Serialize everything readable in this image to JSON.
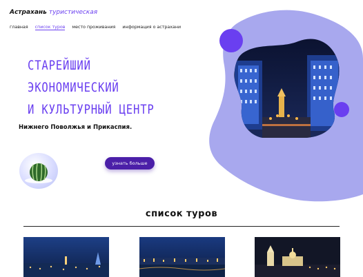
{
  "header": {
    "logo_part1": "Астрахань",
    "logo_part2": "туристическая"
  },
  "nav": {
    "items": [
      {
        "label": "главная",
        "active": false
      },
      {
        "label": "список туров",
        "active": true
      },
      {
        "label": "место проживания",
        "active": false
      },
      {
        "label": "информация о астрахани",
        "active": false
      }
    ]
  },
  "hero": {
    "title_line1": "Старейший",
    "title_line2": "экономический",
    "title_line3": "и культурный центр",
    "subtitle": "Нижнего Поволжья и Прикаспия.",
    "button_label": "узнать больше"
  },
  "tours": {
    "title": "список туров",
    "cards": [
      {
        "image": "night-city-panorama"
      },
      {
        "image": "night-river-embankment"
      },
      {
        "image": "night-kremlin-cathedral"
      }
    ]
  },
  "colors": {
    "accent": "#6a3ff0",
    "lavender": "#a8a8ee",
    "button": "#4b1fa8"
  }
}
